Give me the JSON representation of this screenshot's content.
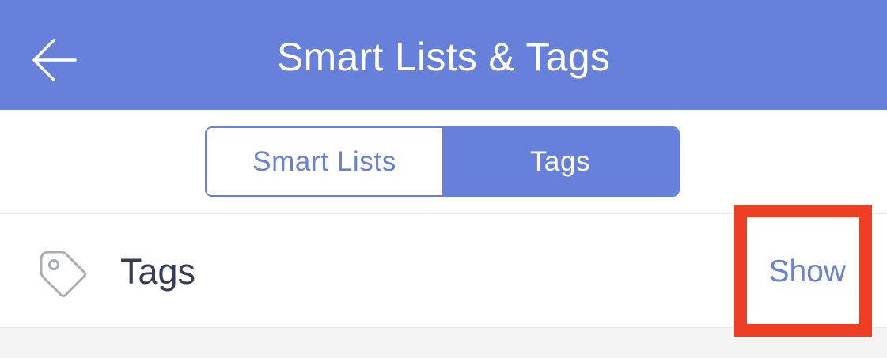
{
  "nav": {
    "title": "Smart Lists & Tags",
    "back_icon": "arrow-left-icon",
    "color": "#6780da"
  },
  "segments": [
    {
      "label": "Smart Lists",
      "selected": false
    },
    {
      "label": "Tags",
      "selected": true
    }
  ],
  "tags_row": {
    "icon": "tag-icon",
    "label": "Tags",
    "action_label": "Show"
  },
  "highlight": {
    "target": "show-button",
    "color": "#ee3f24"
  }
}
